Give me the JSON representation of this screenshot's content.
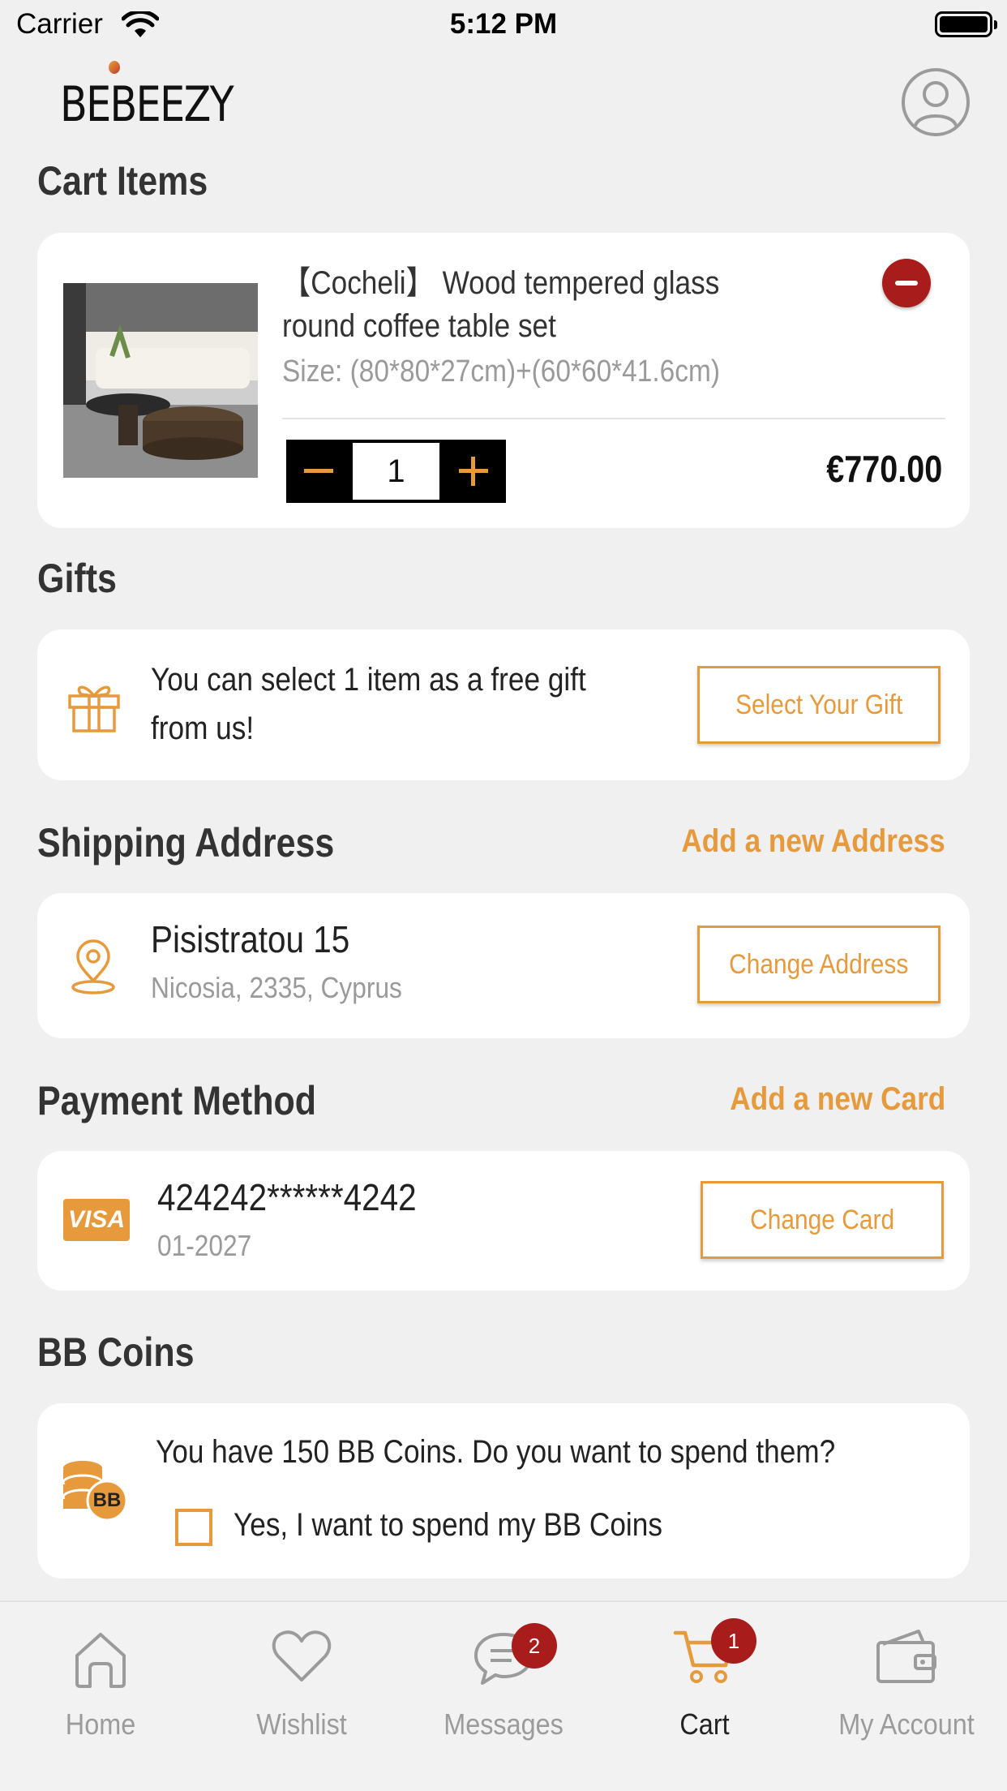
{
  "status_bar": {
    "carrier": "Carrier",
    "time": "5:12 PM"
  },
  "header": {
    "logo": "BEBEEZY"
  },
  "cart": {
    "title": "Cart Items",
    "item": {
      "name": "【Cocheli】 Wood tempered glass round coffee table set",
      "size": "Size: (80*80*27cm)+(60*60*41.6cm)",
      "quantity": "1",
      "price": "€770.00"
    }
  },
  "gifts": {
    "title": "Gifts",
    "message": "You can select 1 item as a free gift from us!",
    "button": "Select Your Gift"
  },
  "shipping": {
    "title": "Shipping Address",
    "add_link": "Add a new Address",
    "street": "Pisistratou 15",
    "city": "Nicosia, 2335, Cyprus",
    "button": "Change Address"
  },
  "payment": {
    "title": "Payment Method",
    "add_link": "Add a new Card",
    "card_brand": "VISA",
    "card_number": "424242******4242",
    "expiry": "01-2027",
    "button": "Change Card"
  },
  "coins": {
    "title": "BB Coins",
    "coin_label": "BB",
    "message": "You have 150 BB Coins. Do you want to spend them?",
    "checkbox_label": "Yes, I want to spend my BB Coins",
    "checked": false
  },
  "tabbar": {
    "tabs": [
      {
        "label": "Home",
        "icon": "home-icon",
        "badge": null,
        "active": false
      },
      {
        "label": "Wishlist",
        "icon": "heart-icon",
        "badge": null,
        "active": false
      },
      {
        "label": "Messages",
        "icon": "chat-icon",
        "badge": "2",
        "active": false
      },
      {
        "label": "Cart",
        "icon": "cart-icon",
        "badge": "1",
        "active": true
      },
      {
        "label": "My Account",
        "icon": "wallet-icon",
        "badge": null,
        "active": false
      }
    ]
  },
  "colors": {
    "accent": "#e69a3c",
    "danger": "#a81c1c",
    "background": "#f0f0f0"
  }
}
